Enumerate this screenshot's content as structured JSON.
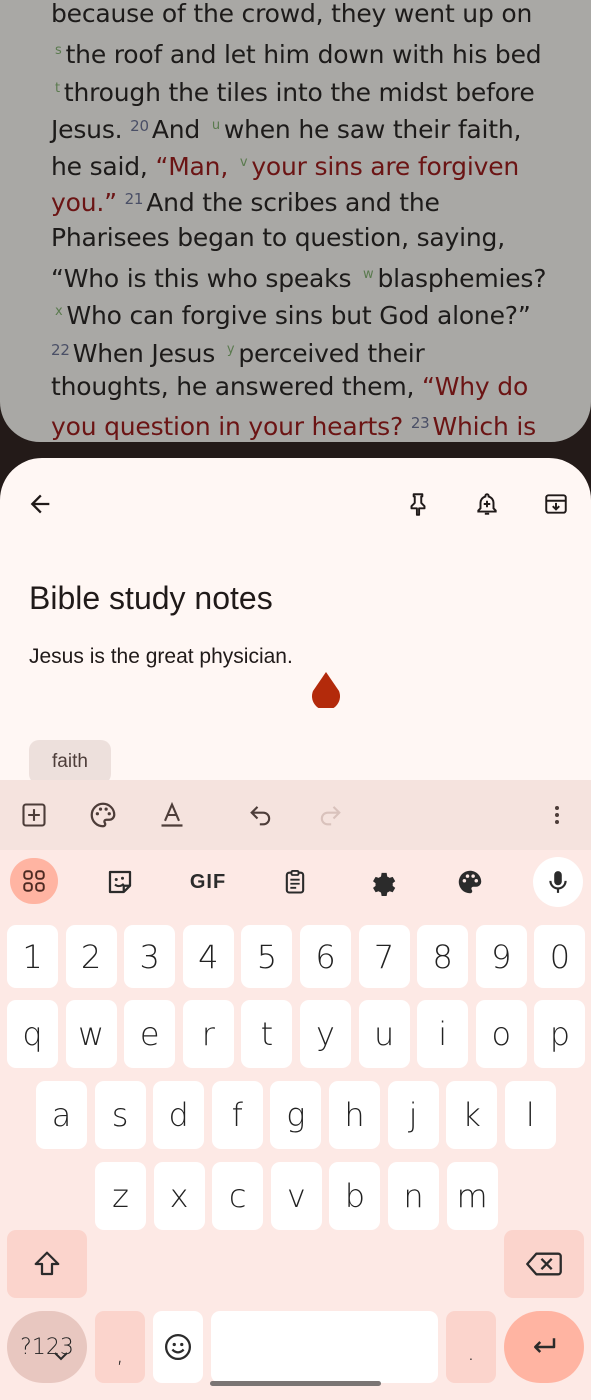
{
  "bible": {
    "lines": [
      [
        {
          "t": "because of the crowd, they went up on"
        }
      ],
      [
        {
          "f": "s"
        },
        {
          "t": "the roof and let him down with his bed"
        }
      ],
      [
        {
          "f": "t"
        },
        {
          "t": "through the tiles into the midst before"
        }
      ],
      [
        {
          "t": "Jesus. "
        },
        {
          "v": "20"
        },
        {
          "t": "And "
        },
        {
          "f": "u"
        },
        {
          "t": "when he saw their faith,"
        }
      ],
      [
        {
          "t": "he said, "
        },
        {
          "t": "“Man, ",
          "r": 1
        },
        {
          "f": "v"
        },
        {
          "t": "your sins are forgiven",
          "r": 1
        }
      ],
      [
        {
          "t": "you.” ",
          "r": 1
        },
        {
          "v": "21"
        },
        {
          "t": "And the scribes and the"
        }
      ],
      [
        {
          "t": "Pharisees began to question, saying,"
        }
      ],
      [
        {
          "t": "“Who is this who speaks "
        },
        {
          "f": "w"
        },
        {
          "t": "blasphemies?"
        }
      ],
      [
        {
          "f": "x"
        },
        {
          "t": "Who can forgive sins but God alone?”"
        }
      ],
      [
        {
          "v": "22"
        },
        {
          "t": "When Jesus "
        },
        {
          "f": "y"
        },
        {
          "t": "perceived their"
        }
      ],
      [
        {
          "t": "thoughts, he answered them, "
        },
        {
          "t": "“Why do",
          "r": 1
        }
      ],
      [
        {
          "t": "you question in your hearts? ",
          "r": 1
        },
        {
          "v": "23"
        },
        {
          "t": "Which is",
          "r": 1
        }
      ]
    ]
  },
  "note": {
    "title": "Bible study notes",
    "body": "Jesus is the great physician.",
    "label_chip": "faith",
    "top_icons": [
      "back-arrow-icon",
      "pin-icon",
      "reminder-bell-icon",
      "archive-icon"
    ],
    "format_icons": [
      "add-box-icon",
      "palette-icon",
      "text-format-icon",
      "undo-icon",
      "redo-icon",
      "more-vert-icon"
    ]
  },
  "keyboard": {
    "toolbar_icons": [
      "apps-grid-icon",
      "sticker-icon",
      "gif-icon",
      "clipboard-icon",
      "settings-gear-icon",
      "theme-palette-icon",
      "microphone-icon"
    ],
    "gif_label": "GIF",
    "row_numbers": [
      "1",
      "2",
      "3",
      "4",
      "5",
      "6",
      "7",
      "8",
      "9",
      "0"
    ],
    "row1": [
      "q",
      "w",
      "e",
      "r",
      "t",
      "y",
      "u",
      "i",
      "o",
      "p"
    ],
    "row2": [
      "a",
      "s",
      "d",
      "f",
      "g",
      "h",
      "j",
      "k",
      "l"
    ],
    "row3": [
      "z",
      "x",
      "c",
      "v",
      "b",
      "n",
      "m"
    ],
    "sym_label": "?123",
    "comma": ",",
    "period": ".",
    "colors": {
      "accent": "#ffb4a2",
      "modifier": "#fbd4cc",
      "background": "#fde9e5"
    }
  },
  "colors": {
    "red_letter": "#6b1414",
    "drop": "#b32a0b"
  }
}
